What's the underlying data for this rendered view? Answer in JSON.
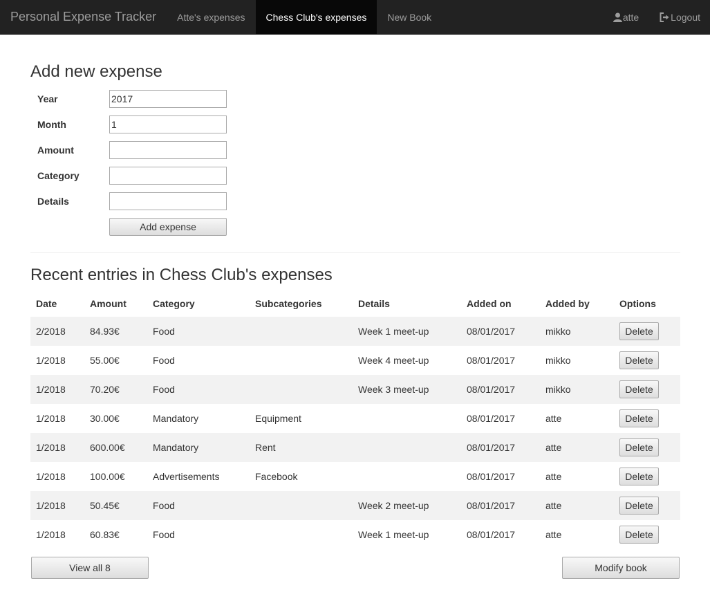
{
  "navbar": {
    "brand": "Personal Expense Tracker",
    "items": [
      {
        "label": "Atte's expenses",
        "active": false
      },
      {
        "label": "Chess Club's expenses",
        "active": true
      },
      {
        "label": "New Book",
        "active": false
      }
    ],
    "user": {
      "icon": "user-icon",
      "label": "atte"
    },
    "logout": {
      "icon": "logout-icon",
      "label": "Logout"
    }
  },
  "form": {
    "title": "Add new expense",
    "year_label": "Year",
    "year_value": "2017",
    "month_label": "Month",
    "month_value": "1",
    "amount_label": "Amount",
    "amount_value": "",
    "category_label": "Category",
    "category_value": "",
    "details_label": "Details",
    "details_value": "",
    "submit_label": "Add expense"
  },
  "table": {
    "title": "Recent entries in Chess Club's expenses",
    "headers": [
      "Date",
      "Amount",
      "Category",
      "Subcategories",
      "Details",
      "Added on",
      "Added by",
      "Options"
    ],
    "rows": [
      {
        "date": "2/2018",
        "amount": "84.93€",
        "category": "Food",
        "subcategories": "",
        "details": "Week 1 meet-up",
        "added_on": "08/01/2017",
        "added_by": "mikko",
        "option": "Delete"
      },
      {
        "date": "1/2018",
        "amount": "55.00€",
        "category": "Food",
        "subcategories": "",
        "details": "Week 4 meet-up",
        "added_on": "08/01/2017",
        "added_by": "mikko",
        "option": "Delete"
      },
      {
        "date": "1/2018",
        "amount": "70.20€",
        "category": "Food",
        "subcategories": "",
        "details": "Week 3 meet-up",
        "added_on": "08/01/2017",
        "added_by": "mikko",
        "option": "Delete"
      },
      {
        "date": "1/2018",
        "amount": "30.00€",
        "category": "Mandatory",
        "subcategories": "Equipment",
        "details": "",
        "added_on": "08/01/2017",
        "added_by": "atte",
        "option": "Delete"
      },
      {
        "date": "1/2018",
        "amount": "600.00€",
        "category": "Mandatory",
        "subcategories": "Rent",
        "details": "",
        "added_on": "08/01/2017",
        "added_by": "atte",
        "option": "Delete"
      },
      {
        "date": "1/2018",
        "amount": "100.00€",
        "category": "Advertisements",
        "subcategories": "Facebook",
        "details": "",
        "added_on": "08/01/2017",
        "added_by": "atte",
        "option": "Delete"
      },
      {
        "date": "1/2018",
        "amount": "50.45€",
        "category": "Food",
        "subcategories": "",
        "details": "Week 2 meet-up",
        "added_on": "08/01/2017",
        "added_by": "atte",
        "option": "Delete"
      },
      {
        "date": "1/2018",
        "amount": "60.83€",
        "category": "Food",
        "subcategories": "",
        "details": "Week 1 meet-up",
        "added_on": "08/01/2017",
        "added_by": "atte",
        "option": "Delete"
      }
    ],
    "view_all_label": "View all 8",
    "modify_label": "Modify book"
  }
}
